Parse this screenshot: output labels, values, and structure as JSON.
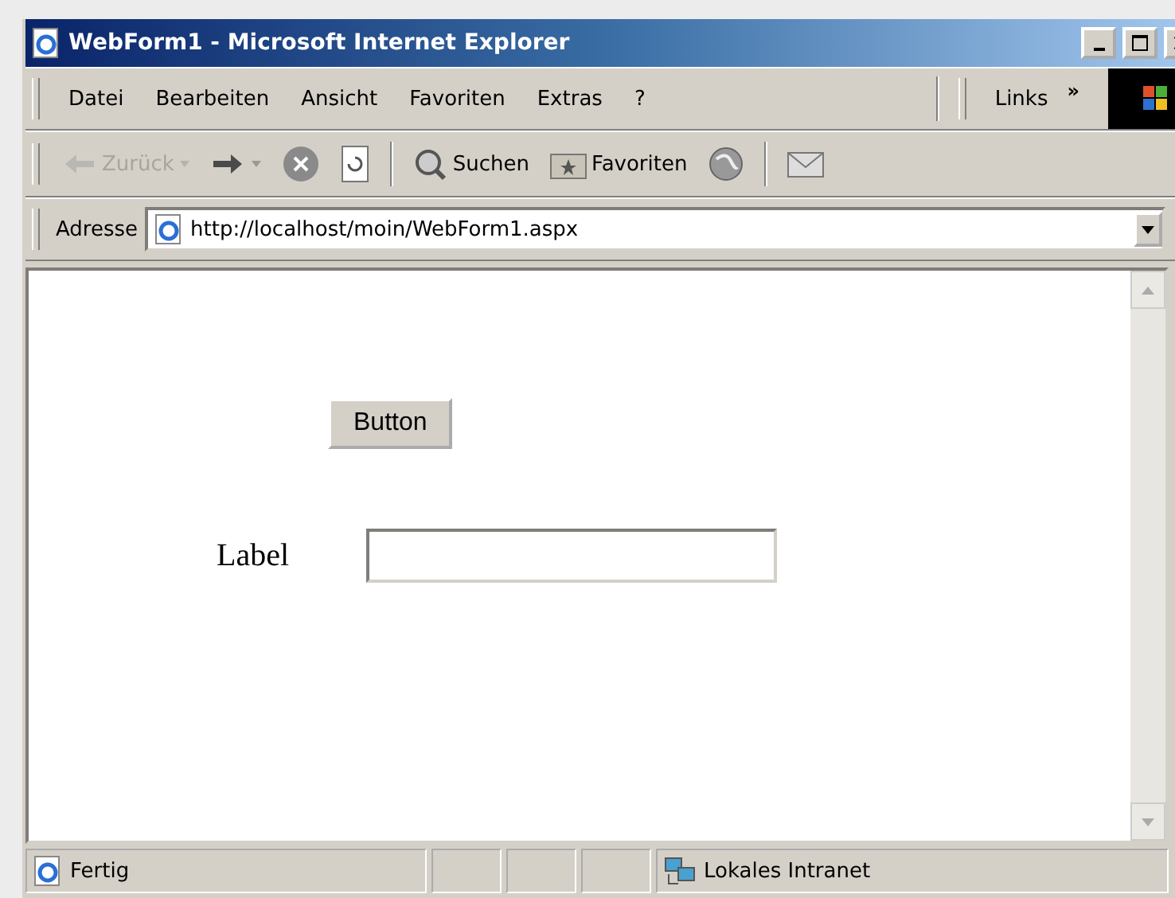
{
  "window": {
    "title": "WebForm1 - Microsoft Internet Explorer"
  },
  "menu": [
    "Datei",
    "Bearbeiten",
    "Ansicht",
    "Favoriten",
    "Extras",
    "?"
  ],
  "links": {
    "label": "Links",
    "more": "»"
  },
  "toolbar": [
    {
      "kind": "back",
      "label": "Zurück",
      "disabled": true
    },
    {
      "kind": "forward",
      "disabled": false
    },
    {
      "kind": "stop",
      "disabled": false
    },
    {
      "kind": "refresh",
      "disabled": false
    },
    {
      "kind": "search",
      "label": "Suchen",
      "disabled": false
    },
    {
      "kind": "favorites",
      "label": "Favoriten",
      "disabled": false
    },
    {
      "kind": "media",
      "disabled": false
    },
    {
      "kind": "mail",
      "disabled": false
    }
  ],
  "address": {
    "label": "Adresse",
    "value": "http://localhost/moin/WebForm1.aspx"
  },
  "page": {
    "button": "Button",
    "label": "Label"
  },
  "status_bar": {
    "text": "Fertig",
    "zone": "Lokales Intranet"
  }
}
